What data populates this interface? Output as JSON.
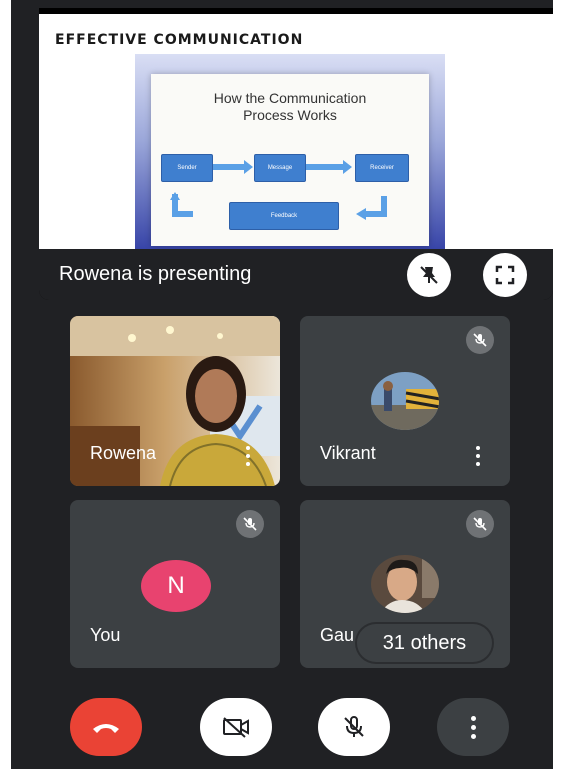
{
  "presentation": {
    "slide_header": "EFFECTIVE COMMUNICATION",
    "slide_title_line1": "How the Communication",
    "slide_title_line2": "Process Works",
    "boxes": {
      "sender": "Sender",
      "message": "Message",
      "receiver": "Receiver",
      "feedback": "Feedback"
    },
    "presenting_label": "Rowena is presenting",
    "icons": {
      "unpin": "pin-off-icon",
      "fullscreen": "fullscreen-icon"
    }
  },
  "participants": [
    {
      "name": "Rowena",
      "video": true,
      "muted": false
    },
    {
      "name": "Vikrant",
      "video": false,
      "muted": true
    },
    {
      "name": "You",
      "initial": "N",
      "video": false,
      "muted": true
    },
    {
      "name": "Gau",
      "video": false,
      "muted": true
    }
  ],
  "others_label": "31 others",
  "controls": {
    "end_call": "phone-hangup-icon",
    "camera": "camera-off-icon",
    "mic": "mic-off-icon",
    "more": "more-vertical-icon"
  },
  "colors": {
    "background": "#202124",
    "tile": "#3c4043",
    "end_call": "#ea4335",
    "avatar": "#e8436f"
  }
}
